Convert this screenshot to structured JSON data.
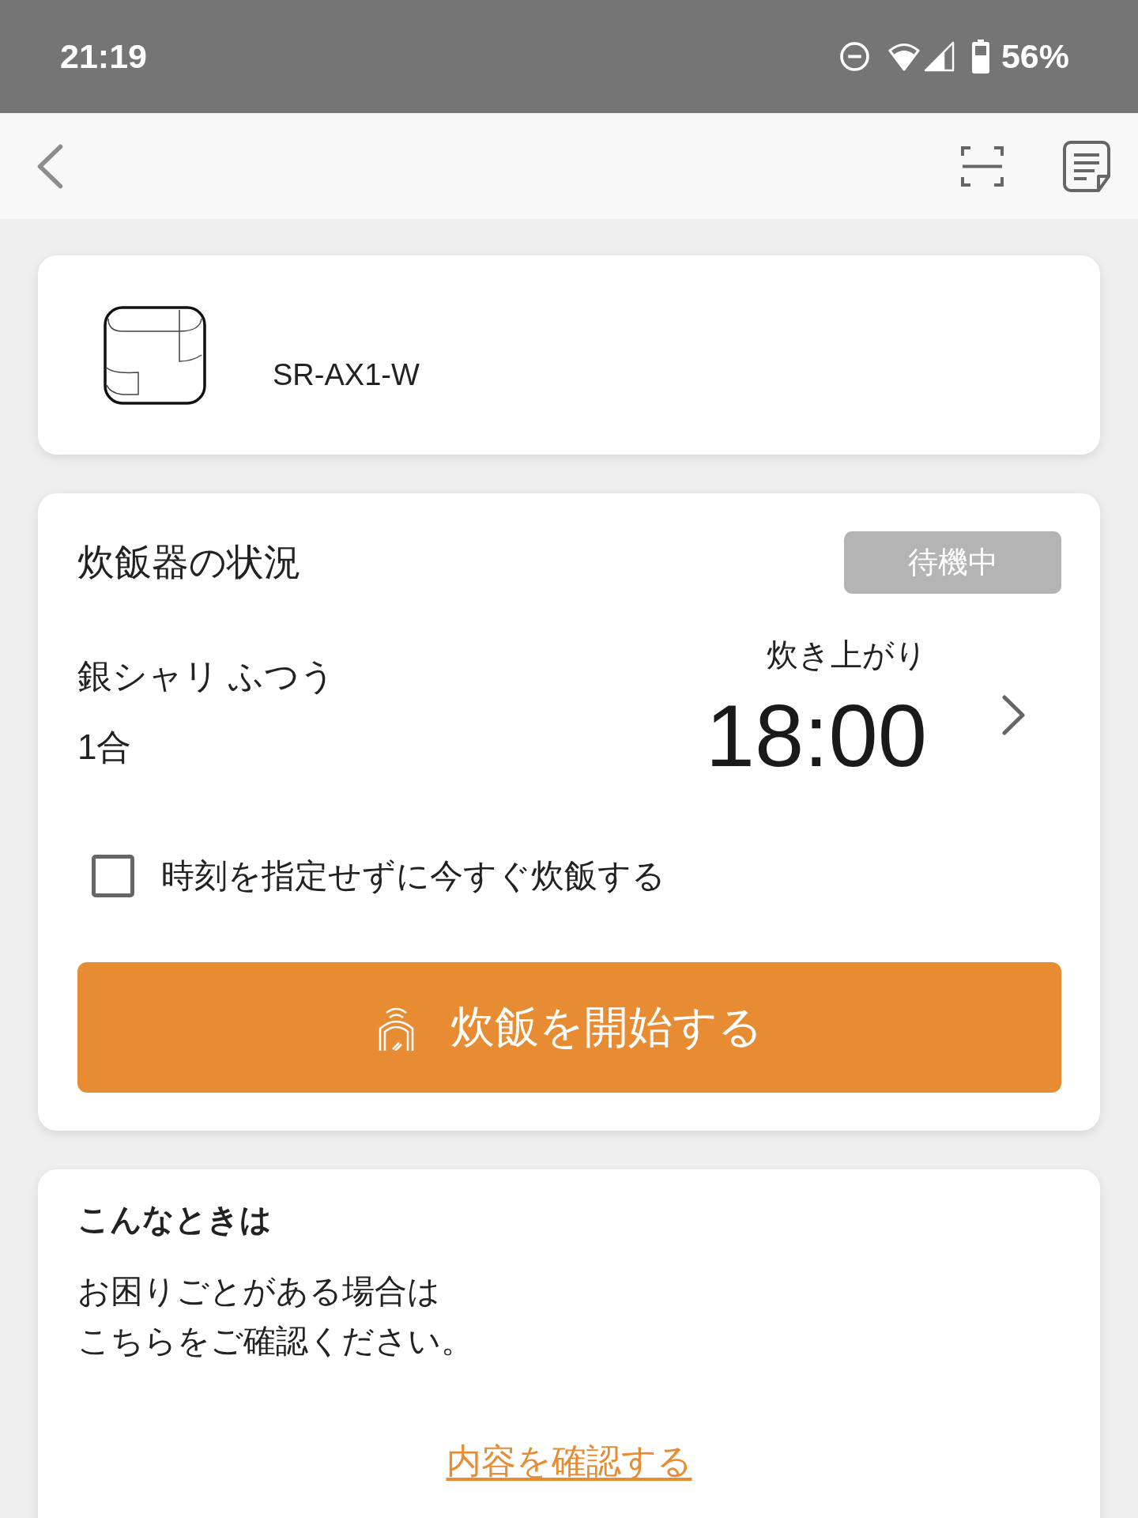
{
  "status_bar": {
    "time": "21:19",
    "battery": "56%"
  },
  "device": {
    "model": "SR-AX1-W"
  },
  "cooker_status": {
    "title": "炊飯器の状況",
    "state_badge": "待機中",
    "course": "銀シャリ ふつう",
    "amount": "1合",
    "finish_label": "炊き上がり",
    "finish_time": "18:00",
    "cook_now": {
      "label": "時刻を指定せずに今すぐ炊飯する",
      "checked": false
    },
    "start_button": "炊飯を開始する"
  },
  "help": {
    "title": "こんなときは",
    "text_lines": [
      "お困りごとがある場合は",
      "こちらをご確認ください。"
    ],
    "link": "内容を確認する"
  }
}
